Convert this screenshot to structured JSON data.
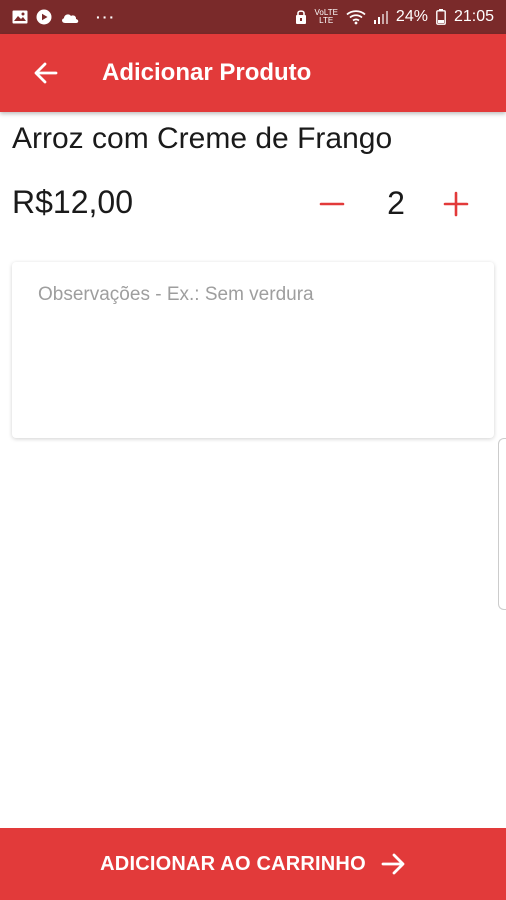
{
  "status_bar": {
    "icons_left": [
      "gallery-icon",
      "youtube-icon",
      "cloud-icon"
    ],
    "more_dots": "···",
    "volte_top": "VoLTE",
    "volte_bottom": "LTE",
    "battery_percent": "24%",
    "time": "21:05"
  },
  "app_bar": {
    "title": "Adicionar Produto",
    "back_icon": "arrow-left-icon"
  },
  "product": {
    "name": "Arroz com Creme de Frango",
    "price": "R$12,00",
    "quantity": "2"
  },
  "notes": {
    "placeholder": "Observações - Ex.: Sem verdura",
    "value": ""
  },
  "footer": {
    "button_label": "ADICIONAR AO CARRINHO"
  },
  "colors": {
    "accent": "#e23a3a",
    "status_bar": "#7a2a2a",
    "text": "#1a1a1a",
    "placeholder": "#9e9e9e"
  }
}
